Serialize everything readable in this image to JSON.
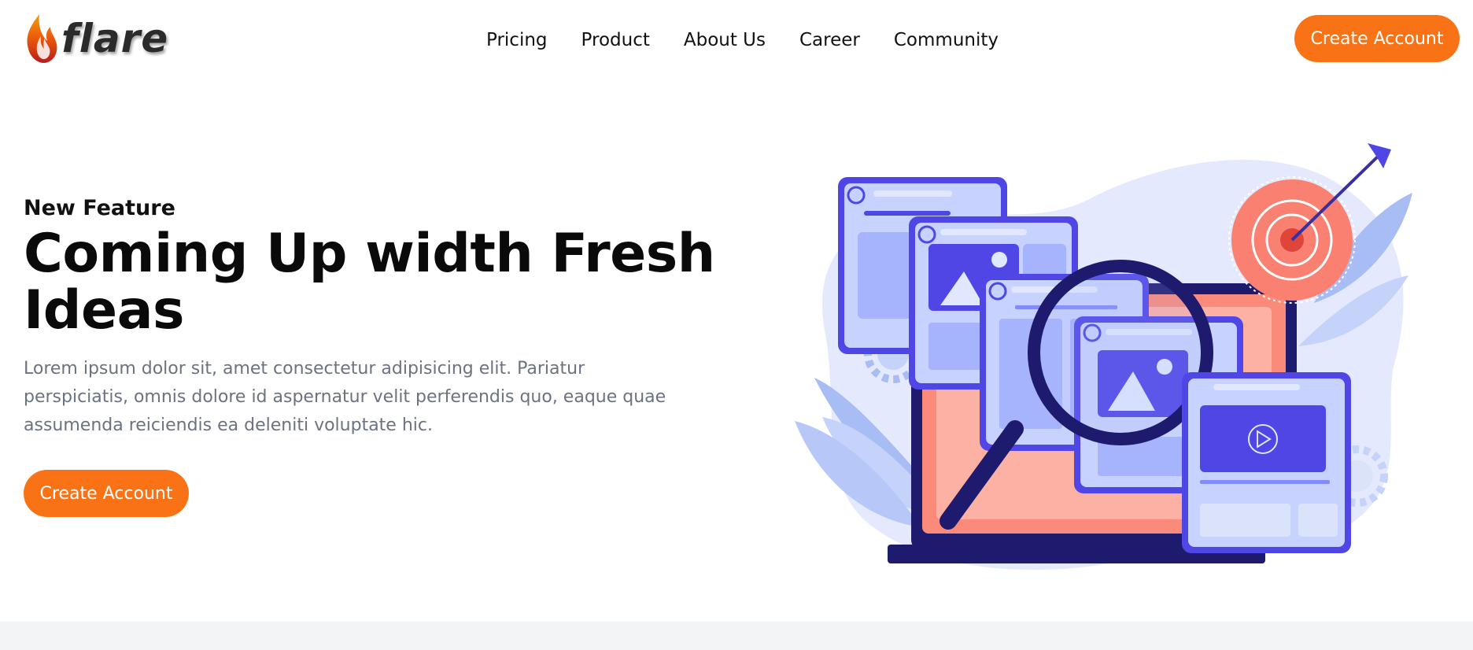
{
  "header": {
    "logo_text": "flare",
    "nav": [
      {
        "label": "Pricing"
      },
      {
        "label": "Product"
      },
      {
        "label": "About Us"
      },
      {
        "label": "Career"
      },
      {
        "label": "Community"
      }
    ],
    "cta_label": "Create Account"
  },
  "hero": {
    "eyebrow": "New Feature",
    "headline": "Coming Up width Fresh Ideas",
    "description": "Lorem ipsum dolor sit, amet consectetur adipisicing elit. Pariatur perspiciatis, omnis dolore id aspernatur velit perferendis quo, eaque quae assumenda reiciendis ea deleniti voluptate hic.",
    "cta_label": "Create Account",
    "illustration_icon": "magnifier-browser-windows-target-illustration"
  },
  "colors": {
    "accent": "#f97316",
    "illustration_primary": "#4f46e5",
    "illustration_dark": "#1e1b6e",
    "illustration_coral": "#fa8072"
  }
}
